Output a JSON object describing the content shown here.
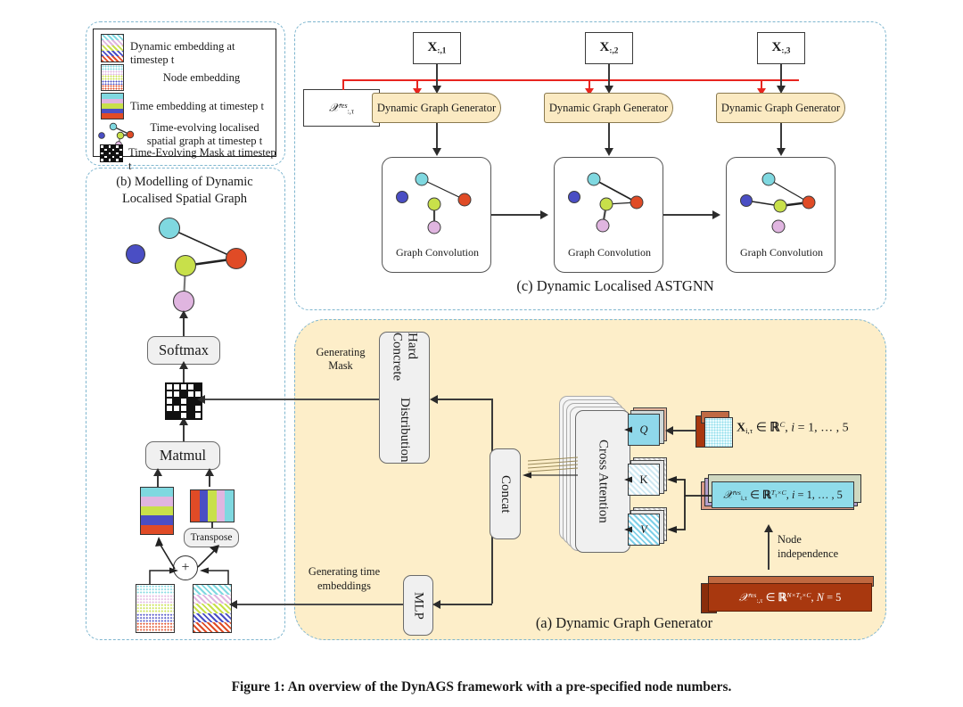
{
  "figure": {
    "caption": "Figure 1: An overview of the DynAGS framework with a pre-specified node numbers."
  },
  "legend": {
    "items": [
      {
        "icon": "dynamic-embedding-swatch",
        "label": "Dynamic embedding at timestep t"
      },
      {
        "icon": "node-embedding-swatch",
        "label": "Node embedding"
      },
      {
        "icon": "time-embedding-swatch",
        "label": "Time embedding at timestep t"
      },
      {
        "icon": "spatial-graph-swatch",
        "label": "Time-evolving localised spatial graph at timestep t"
      },
      {
        "icon": "mask-swatch",
        "label": "Time-Evolving Mask at timestep t"
      }
    ]
  },
  "panel_b": {
    "title_line1": "(b) Modelling of Dynamic",
    "title_line2": "Localised Spatial Graph",
    "softmax_label": "Softmax",
    "matmul_label": "Matmul",
    "transpose_label": "Transpose",
    "plus_label": "+",
    "graph": {
      "nodes": [
        {
          "name": "node-cyan",
          "color": "#7fd8e0"
        },
        {
          "name": "node-blue",
          "color": "#4a4ec4"
        },
        {
          "name": "node-yellowgreen",
          "color": "#c8e04a"
        },
        {
          "name": "node-red",
          "color": "#e04b26"
        },
        {
          "name": "node-pink",
          "color": "#e0b5e0"
        }
      ],
      "edges": [
        "cyan-red",
        "yellowgreen-red",
        "yellowgreen-pink"
      ]
    }
  },
  "panel_c": {
    "title": "(c) Dynamic Localised ASTGNN",
    "inputs": [
      "X:,1",
      "X:,2",
      "X:,3"
    ],
    "residual_box": "X res :,τ",
    "generator_label": "Dynamic Graph Generator",
    "conv_label": "Graph Convolution",
    "columns": [
      {
        "input_sub": "1",
        "conv_label": "Graph Convolution",
        "generator_label": "Dynamic Graph Generator"
      },
      {
        "input_sub": "2",
        "conv_label": "Graph Convolution",
        "generator_label": "Dynamic Graph Generator"
      },
      {
        "input_sub": "3",
        "conv_label": "Graph Convolution",
        "generator_label": "Dynamic Graph Generator"
      }
    ]
  },
  "panel_a": {
    "title": "(a) Dynamic Graph Generator",
    "hard_concrete_line1": "Hard Concrete",
    "hard_concrete_line2": "Distribution",
    "concat_label": "Concat",
    "cross_attention_label": "Cross Attention",
    "mlp_label": "MLP",
    "generating_mask_line1": "Generating",
    "generating_mask_line2": "Mask",
    "generating_time_line1": "Generating time",
    "generating_time_line2": "embeddings",
    "qkv": [
      "Q",
      "K",
      "V"
    ],
    "node_independence_line1": "Node",
    "node_independence_line2": "independence",
    "tensor_x": "X i,τ ∈ ℝ^C, i = 1, … , 5",
    "tensor_xres_i": "𝐳 res i,τ ∈ ℝ^{Tτ×C}, i = 1, … , 5",
    "tensor_xres_all": "𝐳 res :,τ ∈ ℝ^{N×Tτ×C}, N = 5"
  },
  "colors": {
    "panel_fill": "#fdeec9",
    "generator_fill": "#fbeac2",
    "dashed_border": "#7fb6cf",
    "red_arrow": "#e8251f",
    "qkv_fill": "#8fd8ea",
    "tensor_blue": "#8fdcea",
    "tensor_brown": "#a8380f",
    "box_grey": "#f0f0f0"
  },
  "mask_grid": [
    [
      0,
      0,
      0,
      0,
      1
    ],
    [
      0,
      0,
      1,
      0,
      0
    ],
    [
      0,
      1,
      0,
      1,
      1
    ],
    [
      0,
      0,
      0,
      1,
      0
    ],
    [
      1,
      1,
      0,
      1,
      0
    ]
  ],
  "legend_mask_grid": [
    [
      1,
      0,
      1,
      0,
      1
    ],
    [
      0,
      1,
      0,
      1,
      0
    ],
    [
      1,
      0,
      1,
      0,
      1
    ],
    [
      0,
      1,
      0,
      1,
      0
    ],
    [
      1,
      0,
      1,
      0,
      1
    ]
  ],
  "stripe_colors": {
    "node_embedding": [
      "#7fd8e0",
      "#e0b5e0",
      "#c8e04a",
      "#4a4ec4",
      "#e04b26"
    ],
    "time_embedding": [
      "#7fd8e0",
      "#e0b5e0",
      "#c8e04a",
      "#4a4ec4",
      "#e04b26"
    ],
    "transposed": [
      "#e04b26",
      "#4a4ec4",
      "#c8e04a",
      "#e0b5e0",
      "#7fd8e0"
    ],
    "dotted": [
      "#7fd8e0",
      "#e0b5e0",
      "#c8e04a",
      "#4a4ec4",
      "#e04b26"
    ],
    "hatched": [
      "#7fd8e0",
      "#e0b5e0",
      "#c8e04a",
      "#4a4ec4",
      "#e04b26"
    ]
  }
}
